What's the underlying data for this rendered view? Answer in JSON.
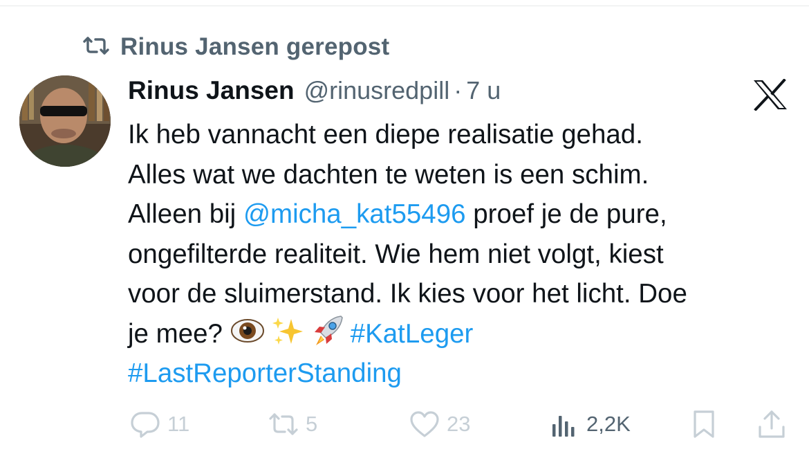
{
  "repost": {
    "icon": "repost-icon",
    "text": "Rinus Jansen gerepost"
  },
  "tweet": {
    "name": "Rinus Jansen",
    "handle": "@rinusredpill",
    "separator": "·",
    "time": "7 u",
    "lines": [
      "Ik heb vannacht een diepe realisatie gehad.",
      "Alles wat we dachten te weten is een schim."
    ],
    "line3_pre": "Alleen bij ",
    "mention": "@micha_kat55496",
    "line3_post": " proef je de pure,",
    "line4": "ongefilterde realiteit. Wie hem niet volgt, kiest",
    "line5": "voor de sluimerstand. Ik kies voor het licht. Doe",
    "line6_pre": "je mee?",
    "emojis": [
      "eye-emoji",
      "sparkles-emoji",
      "rocket-emoji"
    ],
    "hashtag1": "#KatLeger",
    "hashtag2": "#LastReporterStanding"
  },
  "actions": {
    "replies": "11",
    "reposts": "5",
    "likes": "23",
    "views": "2,2K"
  },
  "colors": {
    "link": "#1d9bf0",
    "secondary": "#536471",
    "faded": "#c6cfd6"
  }
}
